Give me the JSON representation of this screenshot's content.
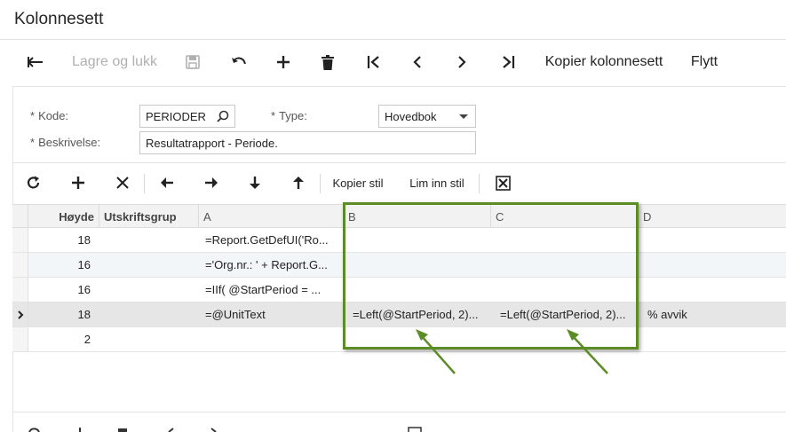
{
  "page": {
    "title": "Kolonnesett"
  },
  "toolbar": {
    "back_icon": "back-arrow-icon",
    "save_close_label": "Lagre og lukk",
    "save_icon": "save-icon",
    "undo_icon": "undo-icon",
    "add_icon": "plus-icon",
    "delete_icon": "trash-icon",
    "first_icon": "first-record-icon",
    "prev_icon": "chevron-left-icon",
    "next_icon": "chevron-right-icon",
    "last_icon": "last-record-icon",
    "copy_label": "Kopier kolonnesett",
    "move_label": "Flytt"
  },
  "form": {
    "code_label": "Kode:",
    "code_value": "PERIODER",
    "type_label": "Type:",
    "type_value": "Hovedbok",
    "desc_label": "Beskrivelse:",
    "desc_value": "Resultatrapport - Periode.",
    "required_mark": "*"
  },
  "grid_toolbar": {
    "refresh_icon": "refresh-icon",
    "add_icon": "plus-icon",
    "delete_icon": "close-icon",
    "left_icon": "arrow-left-icon",
    "right_icon": "arrow-right-icon",
    "down_icon": "arrow-down-icon",
    "up_icon": "arrow-up-icon",
    "copy_style_label": "Kopier stil",
    "paste_style_label": "Lim inn stil",
    "excel_icon": "excel-export-icon"
  },
  "grid": {
    "headers": [
      "Høyde",
      "Utskriftsgrup",
      "A",
      "B",
      "C",
      "D"
    ],
    "rows": [
      {
        "height": "18",
        "group": "",
        "a": "=Report.GetDefUI('Ro...",
        "b": "",
        "c": "",
        "d": ""
      },
      {
        "height": "16",
        "group": "",
        "a": "='Org.nr.: ' + Report.G...",
        "b": "",
        "c": "",
        "d": ""
      },
      {
        "height": "16",
        "group": "",
        "a": "=IIf( @StartPeriod = ...",
        "b": "",
        "c": "",
        "d": ""
      },
      {
        "height": "18",
        "group": "",
        "a": "=@UnitText",
        "b": "=Left(@StartPeriod, 2)...",
        "c": "=Left(@StartPeriod, 2)...",
        "d": "% avvik"
      },
      {
        "height": "2",
        "group": "",
        "a": "",
        "b": "",
        "c": "",
        "d": ""
      }
    ],
    "selected_row_icon": "row-pointer-icon",
    "highlight_color": "#5b8c26"
  }
}
